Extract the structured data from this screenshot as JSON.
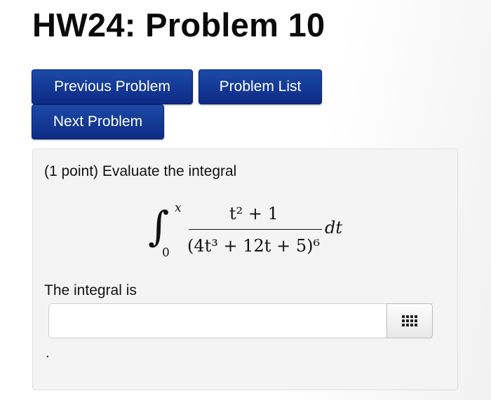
{
  "page": {
    "title": "HW24: Problem 10"
  },
  "nav": {
    "previous_label": "Previous Problem",
    "list_label": "Problem List",
    "next_label": "Next Problem"
  },
  "problem": {
    "prompt": "(1 point) Evaluate the integral",
    "integral": {
      "sign": "∫",
      "upper_limit": "x",
      "lower_limit": "0",
      "numerator": "t² + 1",
      "denominator": "(4t³ + 12t + 5)⁶",
      "differential": "dt"
    },
    "answer_label": "The integral is",
    "answer_value": "",
    "trailing_text": "."
  },
  "icons": {
    "palette_button": "grid-icon"
  },
  "colors": {
    "button_bg": "#12338f",
    "button_text": "#ffffff",
    "panel_bg": "#f4f4f4"
  }
}
